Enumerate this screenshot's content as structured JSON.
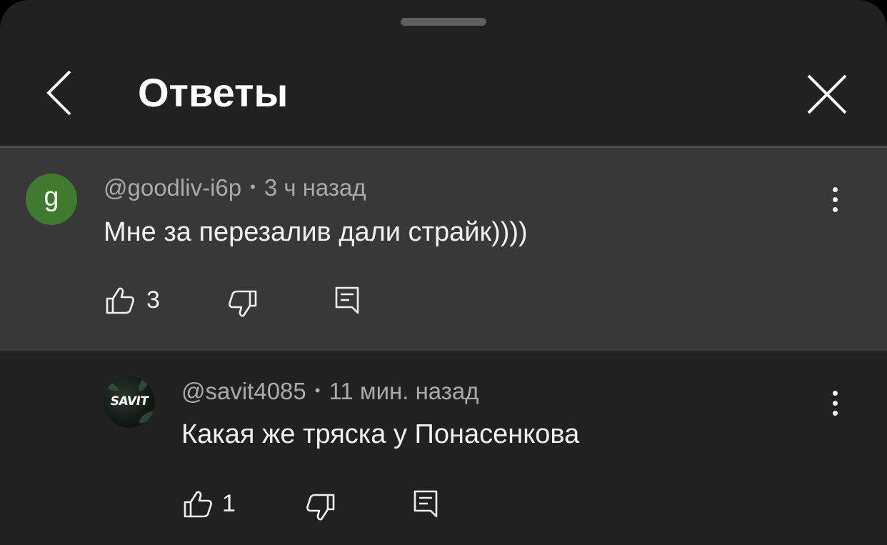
{
  "header": {
    "title": "Ответы"
  },
  "comments": [
    {
      "author": "@goodliv-i6p",
      "separator": "•",
      "time": "3 ч назад",
      "text": "Мне за перезалив дали страйк))))",
      "avatar_letter": "g",
      "avatar_color": "#3f7a2f",
      "likes": "3"
    },
    {
      "author": "@savit4085",
      "separator": "•",
      "time": "11 мин. назад",
      "text": "Какая же тряска у Понасенкова",
      "avatar_logo": "SAVIT",
      "likes": "1"
    }
  ],
  "colors": {
    "sheet_background": "#212121",
    "highlighted_comment_background": "#383838",
    "meta_text": "#aaaaaa",
    "primary_text": "#f1f1f1"
  }
}
